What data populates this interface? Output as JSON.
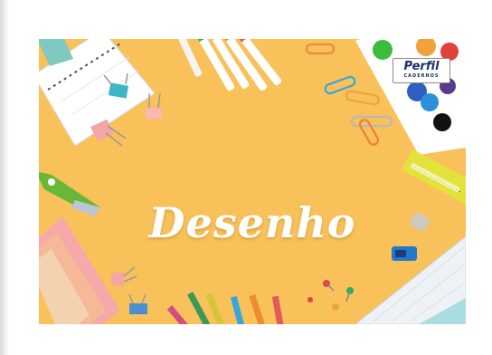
{
  "cover": {
    "title": "Desenho",
    "brand": {
      "name": "Perfil",
      "subtitle": "CADERNOS"
    }
  },
  "colors": {
    "background": "#f8c15a",
    "paper": "#ffffff",
    "brand_blue": "#1b2f6b"
  },
  "icons": [
    "spiral-notebook-icon",
    "binder-clip-icon",
    "paper-clip-icon",
    "marker-pen-icon",
    "watercolor-palette-icon",
    "ruler-icon",
    "pencil-sharpener-icon",
    "push-pin-icon",
    "colored-pencil-icon",
    "set-square-icon",
    "paper-cutter-icon",
    "sticky-note-icon"
  ]
}
